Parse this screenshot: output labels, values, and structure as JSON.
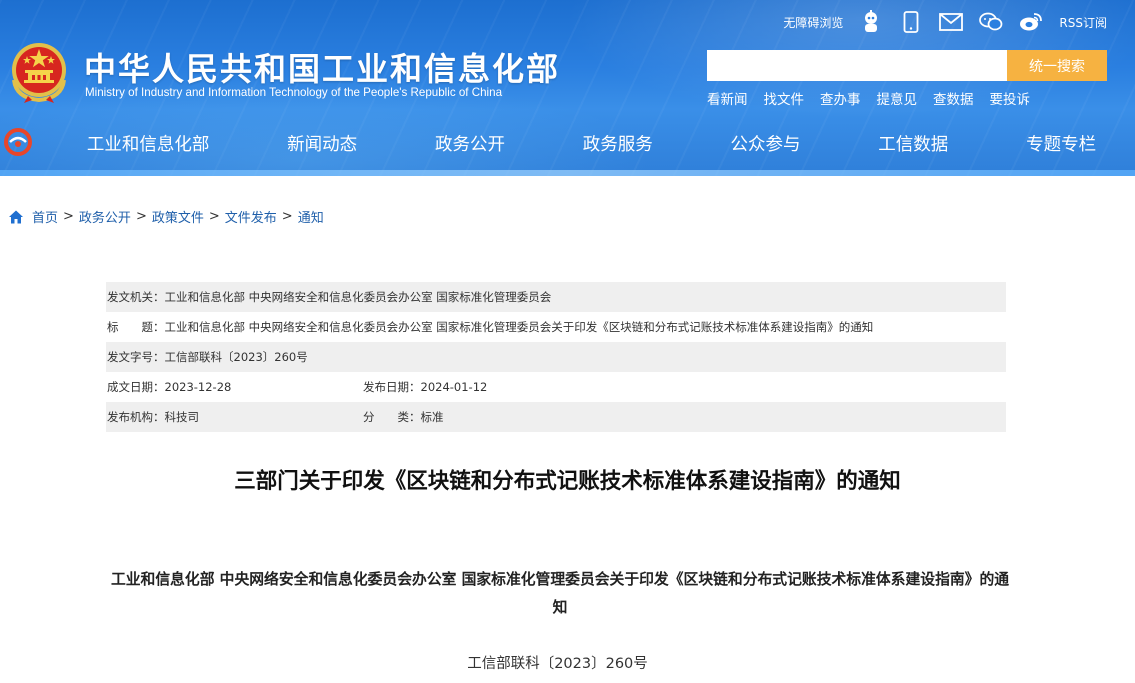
{
  "header": {
    "site_title": "中华人民共和国工业和信息化部",
    "site_subtitle": "Ministry of Industry and Information Technology of the People's Republic of China",
    "accessibility": "无障碍浏览",
    "rss": "RSS订阅",
    "icons": [
      "robot-icon",
      "mobile-icon",
      "mail-icon",
      "wechat-icon",
      "weibo-icon"
    ],
    "search": {
      "placeholder": "",
      "button": "统一搜索"
    },
    "quick_links": [
      "看新闻",
      "找文件",
      "查办事",
      "提意见",
      "查数据",
      "要投诉"
    ],
    "nav": [
      "工业和信息化部",
      "新闻动态",
      "政务公开",
      "政务服务",
      "公众参与",
      "工信数据",
      "专题专栏"
    ],
    "colors": {
      "header_blue": "#2a7fe0",
      "search_button": "#f6b241",
      "emblem_red": "#d7261f"
    }
  },
  "breadcrumb": [
    "首页",
    "政务公开",
    "政策文件",
    "文件发布",
    "通知"
  ],
  "info": {
    "issuer_label": "发文机关：",
    "issuer": "工业和信息化部 中央网络安全和信息化委员会办公室 国家标准化管理委员会",
    "title_label": "标　　题：",
    "title": "工业和信息化部 中央网络安全和信息化委员会办公室 国家标准化管理委员会关于印发《区块链和分布式记账技术标准体系建设指南》的通知",
    "docno_label": "发文字号：",
    "docno": "工信部联科〔2023〕260号",
    "created_label": "成文日期：",
    "created": "2023-12-28",
    "published_label": "发布日期：",
    "published": "2024-01-12",
    "org_label": "发布机构：",
    "org": "科技司",
    "category_label": "分　　类：",
    "category": "标准"
  },
  "article": {
    "title": "三部门关于印发《区块链和分布式记账技术标准体系建设指南》的通知",
    "subtitle": "工业和信息化部 中央网络安全和信息化委员会办公室 国家标准化管理委员会关于印发《区块链和分布式记账技术标准体系建设指南》的通知",
    "doc_number": "工信部联科〔2023〕260号"
  }
}
